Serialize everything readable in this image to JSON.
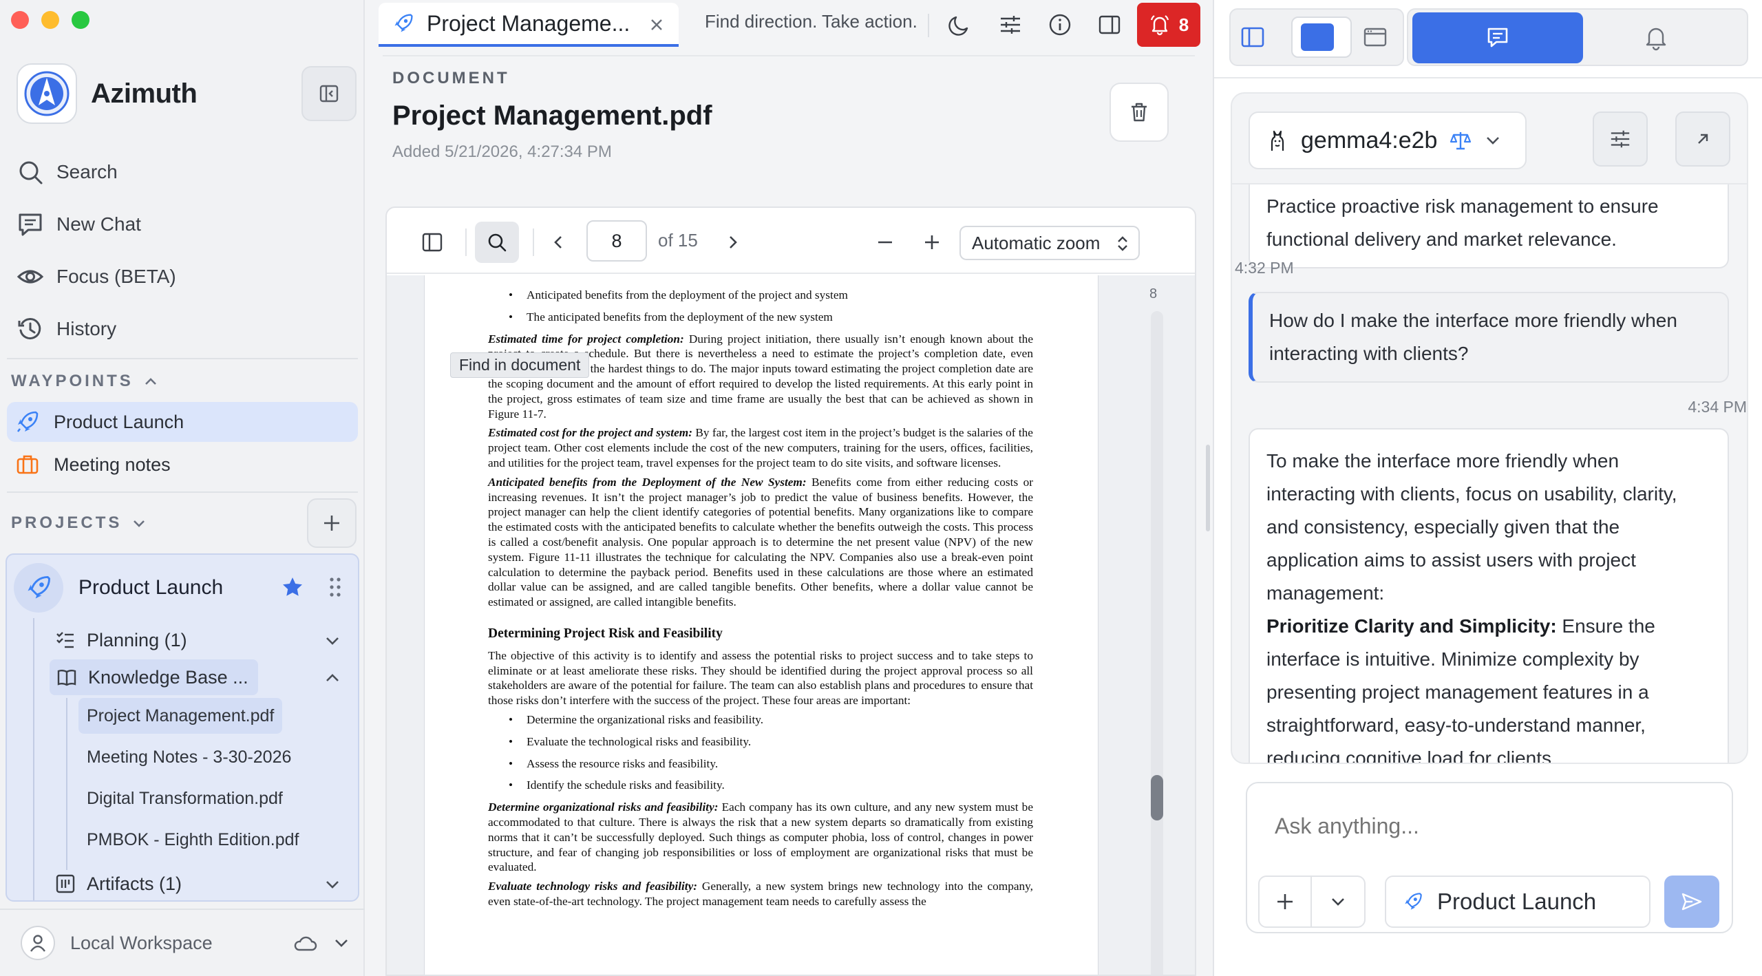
{
  "app": {
    "name": "Azimuth"
  },
  "sidebar": {
    "nav": [
      {
        "label": "Search",
        "icon": "search-icon"
      },
      {
        "label": "New Chat",
        "icon": "chat-icon"
      },
      {
        "label": "Focus (BETA)",
        "icon": "eye-icon"
      },
      {
        "label": "History",
        "icon": "history-icon"
      }
    ],
    "waypoints_label": "WAYPOINTS",
    "waypoints": [
      {
        "label": "Product Launch",
        "icon": "rocket-icon",
        "active": true
      },
      {
        "label": "Meeting notes",
        "icon": "briefcase-icon",
        "active": false
      }
    ],
    "projects_label": "PROJECTS",
    "project": {
      "title": "Product Launch",
      "starred": true,
      "groups": [
        {
          "label": "Planning (1)",
          "icon": "checklist-icon",
          "expanded": false
        },
        {
          "label": "Knowledge Base ...",
          "icon": "book-icon",
          "expanded": true
        },
        {
          "label": "Artifacts (1)",
          "icon": "artifact-icon",
          "expanded": false
        }
      ],
      "documents": [
        {
          "label": "Project Management.pdf",
          "selected": true
        },
        {
          "label": "Meeting Notes - 3-30-2026",
          "selected": false
        },
        {
          "label": "Digital Transformation.pdf",
          "selected": false
        },
        {
          "label": "PMBOK - Eighth Edition.pdf",
          "selected": false
        }
      ]
    },
    "workspace": "Local Workspace"
  },
  "tabbar": {
    "tab_title": "Project Manageme...",
    "tagline": "Find direction. Take action.",
    "notification_count": "8"
  },
  "document": {
    "kicker": "DOCUMENT",
    "title": "Project Management.pdf",
    "added": "Added 5/21/2026, 4:27:34 PM"
  },
  "viewer": {
    "page": "8",
    "of_pages": "of 15",
    "zoom": "Automatic zoom",
    "find_tooltip": "Find in document",
    "thumb_page": "8"
  },
  "pdf": {
    "bullets_top": [
      "Anticipated benefits from the deployment of the project and system",
      "The anticipated benefits from the deployment of the new system"
    ],
    "p1_lead": "Estimated time for project completion:",
    "p1": " During project initiation, there usually isn’t enough known about the project to create a schedule. But there is nevertheless a need to estimate the project’s completion date, even though this is one of the hardest things to do. The major inputs toward estimating the project completion date are the scoping document and the amount of effort required to develop the listed requirements. At this early point in the project, gross estimates of team size and time frame are usually the best that can be achieved as shown in Figure 11-7.",
    "p2_lead": "Estimated cost for the project and system:",
    "p2": " By far, the largest cost item in the project’s budget is the salaries of the project team. Other cost elements include the cost of the new computers, training for the users, offices, facilities, and utilities for the project team, travel expenses for the project team to do site visits, and software licenses.",
    "p3_lead": "Anticipated benefits from the Deployment of the New System:",
    "p3": " Benefits come from either reducing costs or increasing revenues. It isn’t the project manager’s job to predict the value of business benefits. However, the project manager can help the client identify categories of potential benefits. Many organizations like to compare the estimated costs with the anticipated benefits to calculate whether the benefits outweigh the costs. This process is called a cost/benefit analysis. One popular approach is to determine the net present value (NPV) of the new system. Figure 11-11 illustrates the technique for calculating the NPV. Companies also use a break-even point calculation to determine the payback period. Benefits used in these calculations are those where an estimated dollar value can be assigned, and are called tangible benefits. Other benefits, where a dollar value cannot be estimated or assigned, are called intangible benefits.",
    "heading": "Determining Project Risk and Feasibility",
    "p4": "The objective of this activity is to identify and assess the potential risks to project success and to take steps to eliminate or at least ameliorate these risks. They should be identified during the project approval process so all stakeholders are aware of the potential for failure. The team can also establish plans and procedures to ensure that those risks don’t interfere with the success of the project. These four areas are important:",
    "bullets_risk": [
      "Determine the organizational risks and feasibility.",
      "Evaluate the technological risks and feasibility.",
      "Assess the resource risks and feasibility.",
      "Identify the schedule risks and feasibility."
    ],
    "p5_lead": "Determine organizational risks and feasibility:",
    "p5": " Each company has its own culture, and any new system must be accommodated to that culture. There is always the risk that a new system departs so dramatically from existing norms that it can’t be successfully deployed. Such things as computer phobia, loss of control, changes in power structure, and fear of changing job responsibilities or loss of employment are organizational risks that must be evaluated.",
    "p6_lead": "Evaluate technology risks and feasibility:",
    "p6": " Generally, a new system brings new technology into the company, even state-of-the-art technology. The project management team needs to carefully assess the"
  },
  "chat": {
    "model": "gemma4:e2b",
    "messages": [
      {
        "role": "assistant",
        "text": "Practice proactive risk management to ensure functional delivery and market relevance.",
        "time": "4:32 PM"
      },
      {
        "role": "user",
        "text": "How do I make the interface more friendly when interacting with clients?",
        "time": "4:34 PM"
      },
      {
        "role": "assistant",
        "intro": "To make the interface more friendly when interacting with clients, focus on usability, clarity, and consistency, especially given that the application aims to assist users with project management:",
        "bold": "Prioritize Clarity and Simplicity:",
        "rest": " Ensure the interface is intuitive. Minimize complexity by presenting project management features in a straightforward, easy-to-understand manner, reducing cognitive load for clients."
      }
    ],
    "input_placeholder": "Ask anything...",
    "project_chip": "Product Launch"
  },
  "colors": {
    "accent": "#3b6fe6",
    "alert": "#dc2626",
    "rocket": "#3b82f6",
    "briefcase": "#f97316"
  }
}
